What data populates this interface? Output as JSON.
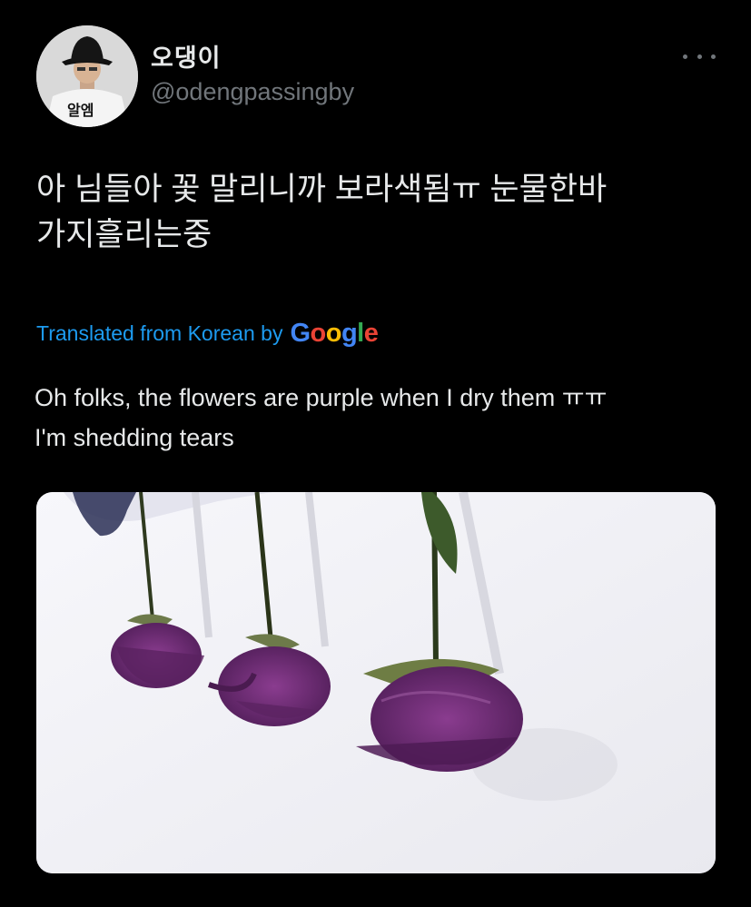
{
  "tweet": {
    "display_name": "오댕이",
    "handle": "@odengpassingby",
    "avatar_text": "알엠",
    "text_line1": "아 님들아 꽃 말리니까 보라색됨ㅠ 눈물한바",
    "text_line2": "가지흘리는중",
    "translated_label": "Translated from Korean by",
    "google_letters": [
      {
        "ch": "G",
        "color": "#4285f4"
      },
      {
        "ch": "o",
        "color": "#ea4335"
      },
      {
        "ch": "o",
        "color": "#fbbc05"
      },
      {
        "ch": "g",
        "color": "#4285f4"
      },
      {
        "ch": "l",
        "color": "#34a853"
      },
      {
        "ch": "e",
        "color": "#ea4335"
      }
    ],
    "translation_line1": "Oh folks, the flowers are purple when I dry them ㅠㅠ",
    "translation_line2": "I'm shedding tears"
  },
  "icons": {
    "more": "more-horizontal-icon"
  },
  "colors": {
    "background": "#000000",
    "primary_text": "#e7e9ea",
    "secondary_text": "#71767b",
    "link_blue": "#1d9bf0",
    "rose_purple": "#6b2a72"
  }
}
